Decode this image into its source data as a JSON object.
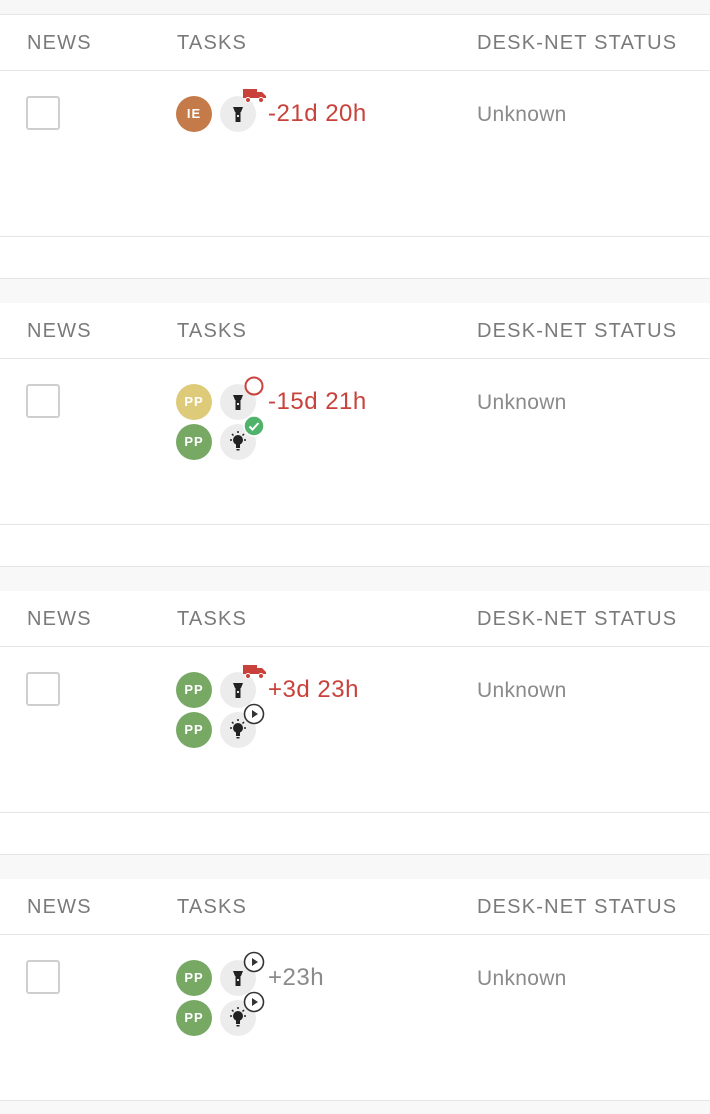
{
  "columns": {
    "news": "NEWS",
    "tasks": "TASKS",
    "status": "DESK-NET STATUS"
  },
  "colors": {
    "overdue": "#c9413b",
    "neutral": "#8a8a8a",
    "avatar_ie": "#c57a4a",
    "avatar_pp_yellow": "#ddcb7a",
    "avatar_pp_green": "#78a964",
    "type_bg": "#ececec",
    "done_green": "#4fb36b"
  },
  "items": [
    {
      "status": "Unknown",
      "checked": false,
      "tasks": [
        {
          "initials": "IE",
          "avatar_color": "#c57a4a",
          "type_icon": "flashlight-icon",
          "state_icon": "truck-icon",
          "time": "-21d 20h",
          "time_style": "overdue"
        }
      ]
    },
    {
      "status": "Unknown",
      "checked": false,
      "tasks": [
        {
          "initials": "PP",
          "avatar_color": "#ddcb7a",
          "type_icon": "flashlight-icon",
          "state_icon": "empty-circle-icon",
          "time": "-15d 21h",
          "time_style": "overdue"
        },
        {
          "initials": "PP",
          "avatar_color": "#78a964",
          "type_icon": "lightbulb-icon",
          "state_icon": "check-circle-icon",
          "time": "",
          "time_style": ""
        }
      ]
    },
    {
      "status": "Unknown",
      "checked": false,
      "tasks": [
        {
          "initials": "PP",
          "avatar_color": "#78a964",
          "type_icon": "flashlight-icon",
          "state_icon": "truck-icon",
          "time": "+3d 23h",
          "time_style": "overdue"
        },
        {
          "initials": "PP",
          "avatar_color": "#78a964",
          "type_icon": "lightbulb-icon",
          "state_icon": "play-circle-icon",
          "time": "",
          "time_style": ""
        }
      ]
    },
    {
      "status": "Unknown",
      "checked": false,
      "tasks": [
        {
          "initials": "PP",
          "avatar_color": "#78a964",
          "type_icon": "flashlight-icon",
          "state_icon": "play-circle-icon",
          "time": "+23h",
          "time_style": "neutral"
        },
        {
          "initials": "PP",
          "avatar_color": "#78a964",
          "type_icon": "lightbulb-icon",
          "state_icon": "play-circle-icon",
          "time": "",
          "time_style": ""
        }
      ]
    }
  ]
}
